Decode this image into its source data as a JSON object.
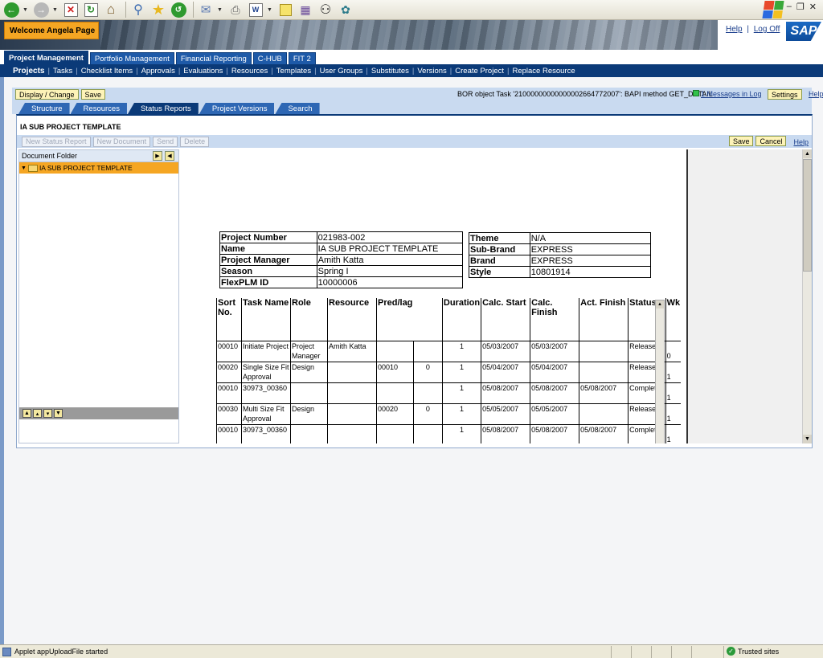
{
  "browser": {
    "toolbar_icons": [
      "back-icon",
      "forward-icon",
      "stop-icon",
      "refresh-icon",
      "home-icon",
      "search-icon",
      "favorites-icon",
      "history-icon",
      "mail-icon",
      "print-icon",
      "edit-icon",
      "notes-icon",
      "research-icon",
      "messenger-icon",
      "tools-icon"
    ]
  },
  "header": {
    "welcome": "Welcome Angela Page",
    "help": "Help",
    "separator": "|",
    "logoff": "Log Off",
    "logo": "SAP"
  },
  "nav_top": {
    "tabs": [
      "Project Management",
      "Portfolio Management",
      "Financial Reporting",
      "C-HUB",
      "FIT 2"
    ]
  },
  "nav_sub": {
    "items": [
      "Projects",
      "Tasks",
      "Checklist Items",
      "Approvals",
      "Evaluations",
      "Resources",
      "Templates",
      "User Groups",
      "Substitutes",
      "Versions",
      "Create Project",
      "Replace Resource"
    ]
  },
  "toolbar": {
    "display_change": "Display / Change",
    "save": "Save",
    "bor_message": "BOR object Task '21000000000000002664772007': BAPI method GET_DETAIL",
    "messages_link": "1 Messages in Log",
    "settings": "Settings",
    "help": "Help"
  },
  "tabs": [
    "Structure",
    "Resources",
    "Status Reports",
    "Project Versions",
    "Search"
  ],
  "panel": {
    "title": "IA SUB PROJECT TEMPLATE",
    "buttons": [
      "New Status Report",
      "New Document",
      "Send",
      "Delete"
    ],
    "save": "Save",
    "cancel": "Cancel",
    "help": "Help"
  },
  "tree": {
    "header": "Document Folder",
    "root": "IA SUB PROJECT TEMPLATE"
  },
  "report": {
    "left_info": [
      {
        "label": "Project Number",
        "value": "021983-002"
      },
      {
        "label": "Name",
        "value": "IA SUB PROJECT TEMPLATE"
      },
      {
        "label": "Project Manager",
        "value": "Amith Katta"
      },
      {
        "label": "Season",
        "value": "Spring I"
      },
      {
        "label": "FlexPLM ID",
        "value": "10000006"
      }
    ],
    "right_info": [
      {
        "label": "Theme",
        "value": "N/A"
      },
      {
        "label": "Sub-Brand",
        "value": "EXPRESS"
      },
      {
        "label": "Brand",
        "value": "EXPRESS"
      },
      {
        "label": "Style",
        "value": "10801914"
      }
    ],
    "columns": [
      "Sort No.",
      "Task Name",
      "Role",
      "Resource",
      "Pred/lag",
      "",
      "Duration",
      "Calc. Start",
      "Calc. Finish",
      "Act. Finish",
      "Status",
      "Wk"
    ],
    "rows": [
      [
        "00010",
        "Initiate Project",
        "Project Manager",
        "Amith Katta",
        "",
        "",
        "1",
        "05/03/2007",
        "05/03/2007",
        "",
        "Released",
        "0"
      ],
      [
        "00020",
        "Single Size Fit Approval",
        "Design",
        "",
        "00010",
        "0",
        "1",
        "05/04/2007",
        "05/04/2007",
        "",
        "Released",
        "1"
      ],
      [
        "00010",
        "30973_00360",
        "",
        "",
        "",
        "",
        "1",
        "05/08/2007",
        "05/08/2007",
        "05/08/2007",
        "Completed",
        "1"
      ],
      [
        "00030",
        "Multi Size Fit Approval",
        "Design",
        "",
        "00020",
        "0",
        "1",
        "05/05/2007",
        "05/05/2007",
        "",
        "Released",
        "1"
      ],
      [
        "00010",
        "30973_00360",
        "",
        "",
        "",
        "",
        "1",
        "05/08/2007",
        "05/08/2007",
        "05/08/2007",
        "Completed",
        "1"
      ]
    ]
  },
  "status": {
    "text": "Applet appUploadFile started",
    "zone": "Trusted sites"
  }
}
